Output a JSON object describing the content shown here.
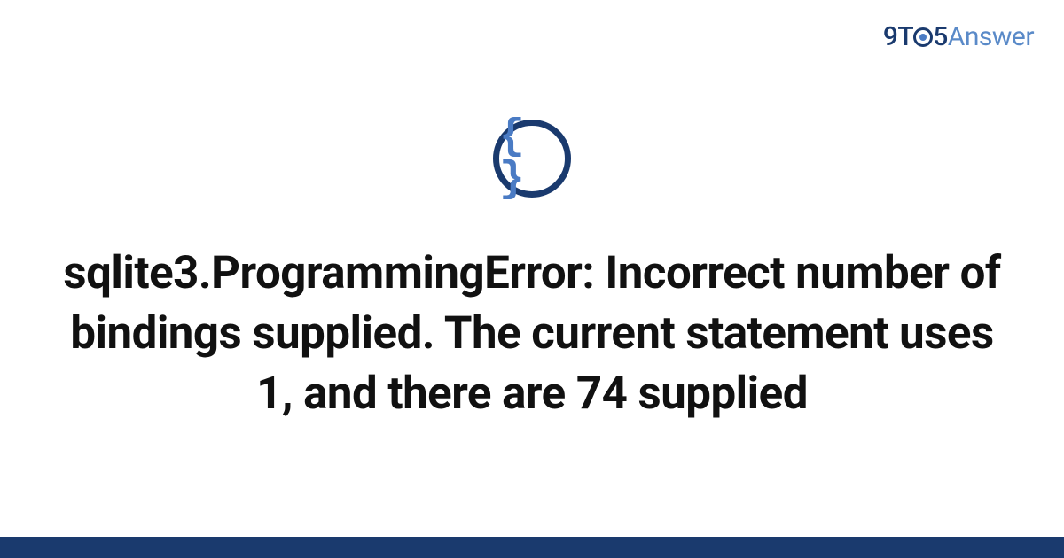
{
  "logo": {
    "part1": "9T",
    "part2": "5",
    "part3": "Answer"
  },
  "icon": {
    "name": "code-braces-icon",
    "glyph": "{ }"
  },
  "title": "sqlite3.ProgrammingError: Incorrect number of bindings supplied. The current statement uses 1, and there are 74 supplied",
  "colors": {
    "brand_dark": "#1a3a6e",
    "brand_light": "#5a8ac8",
    "text": "#111111"
  }
}
